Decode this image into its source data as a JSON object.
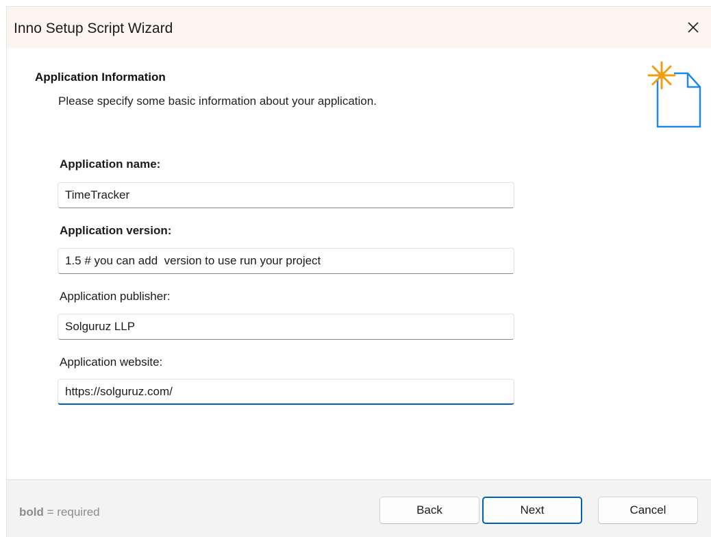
{
  "window": {
    "title": "Inno Setup Script Wizard"
  },
  "page": {
    "title": "Application Information",
    "subtitle": "Please specify some basic information about your application."
  },
  "fields": [
    {
      "label": "Application name:",
      "value": "TimeTracker",
      "required": true
    },
    {
      "label": "Application version:",
      "value": "1.5 # you can add  version to use run your project",
      "required": true
    },
    {
      "label": "Application publisher:",
      "value": "Solguruz LLP",
      "required": false
    },
    {
      "label": "Application website:",
      "value": "https://solguruz.com/",
      "required": false
    }
  ],
  "footer": {
    "legend_bold": "bold",
    "legend_rest": " = required",
    "back_label": "Back",
    "next_label": "Next",
    "cancel_label": "Cancel"
  },
  "colors": {
    "accent": "#005fb8",
    "titlebar": "#fbf4f1",
    "icon_star": "#f39c12",
    "icon_page": "#1e88e5"
  },
  "icons": {
    "close": "close-icon",
    "wizard": "new-document-sparkle-icon"
  }
}
